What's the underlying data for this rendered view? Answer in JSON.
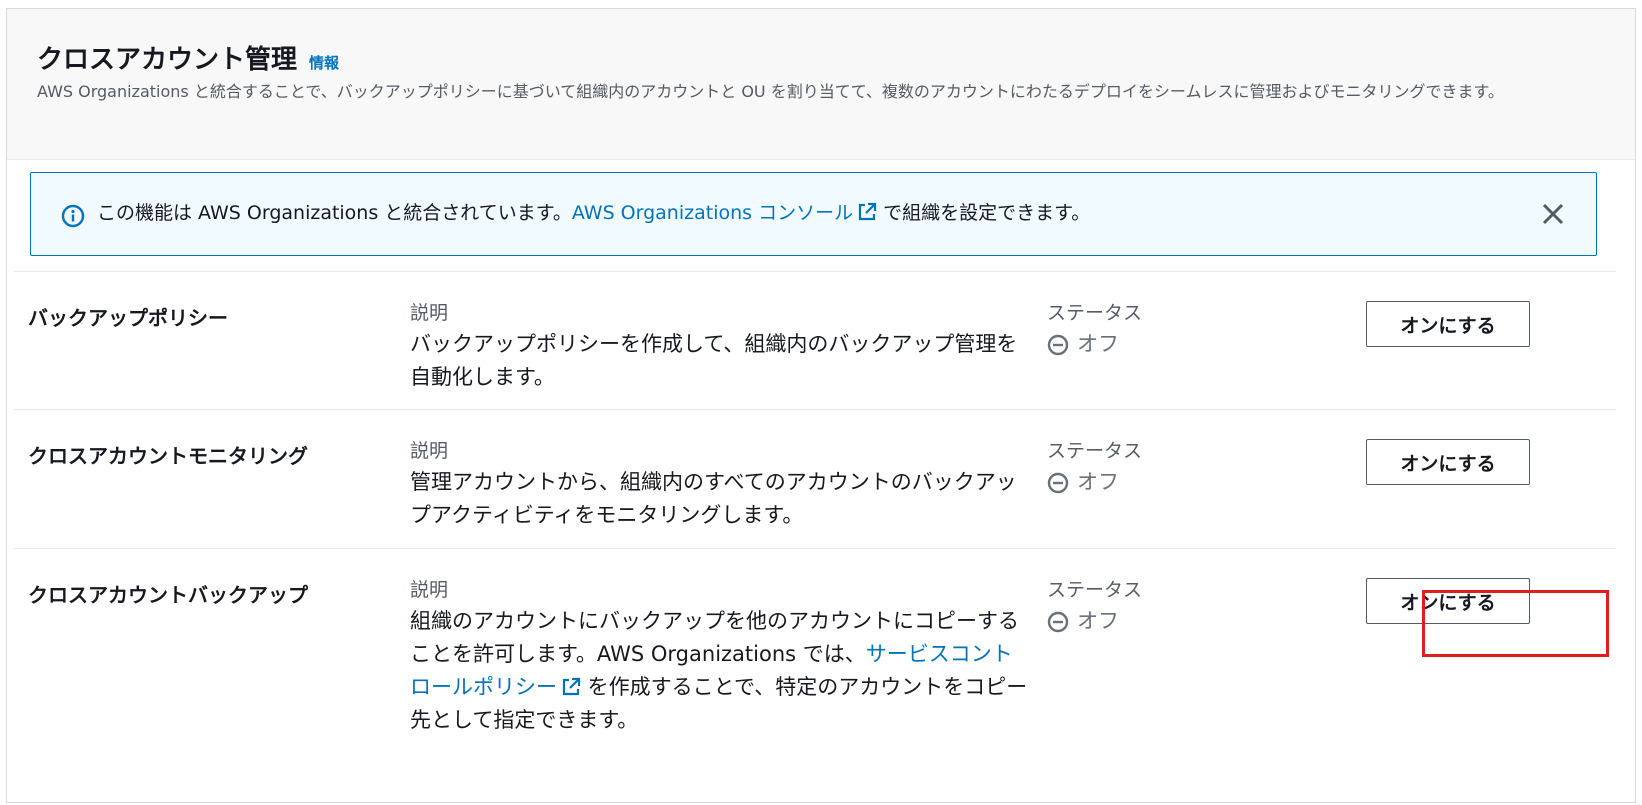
{
  "header": {
    "title": "クロスアカウント管理",
    "info_label": "情報",
    "description": "AWS Organizations と統合することで、バックアップポリシーに基づいて組織内のアカウントと OU を割り当てて、複数のアカウントにわたるデプロイをシームレスに管理およびモニタリングできます。"
  },
  "alert": {
    "text_before": "この機能は AWS Organizations と統合されています。",
    "link_text": "AWS Organizations コンソール",
    "text_after": " で組織を設定できます。",
    "icon": "info-icon",
    "close_icon": "close-icon"
  },
  "features": [
    {
      "title": "バックアップポリシー",
      "description_label": "説明",
      "description": "バックアップポリシーを作成して、組織内のバックアップ管理を自動化します。",
      "status_label": "ステータス",
      "status": "オフ",
      "button_label": "オンにする"
    },
    {
      "title": "クロスアカウントモニタリング",
      "description_label": "説明",
      "description": "管理アカウントから、組織内のすべてのアカウントのバックアップアクティビティをモニタリングします。",
      "status_label": "ステータス",
      "status": "オフ",
      "button_label": "オンにする"
    },
    {
      "title": "クロスアカウントバックアップ",
      "description_label": "説明",
      "description_before": "組織のアカウントにバックアップを他のアカウントにコピーすることを許可します。AWS Organizations では、",
      "description_link": "サービスコントロールポリシー",
      "description_after": " を作成することで、特定のアカウントをコピー先として指定できます。",
      "status_label": "ステータス",
      "status": "オフ",
      "button_label": "オンにする"
    }
  ],
  "colors": {
    "link": "#0073bb",
    "alert_bg": "#f1faff",
    "highlight": "#e01e1e"
  }
}
